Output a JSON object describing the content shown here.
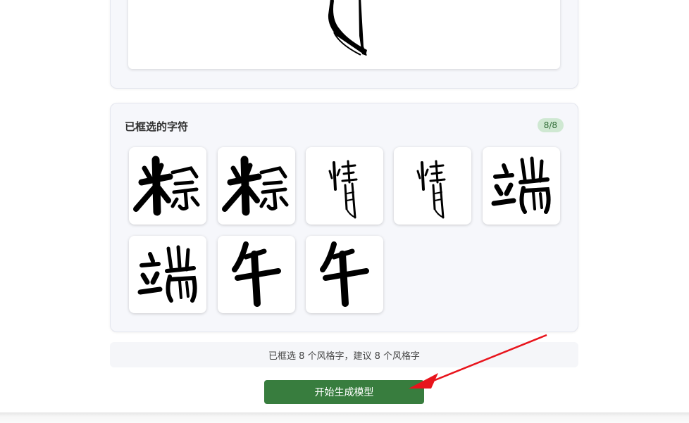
{
  "selected_panel": {
    "title": "已框选的字符",
    "badge": "8/8",
    "glyphs": [
      {
        "char": "粽"
      },
      {
        "char": "粽"
      },
      {
        "char": "情"
      },
      {
        "char": "情"
      },
      {
        "char": "端"
      },
      {
        "char": "端"
      },
      {
        "char": "午"
      },
      {
        "char": "午"
      }
    ]
  },
  "tip": {
    "text": "已框选 8 个风格字，建议 8 个风格字"
  },
  "actions": {
    "generate_label": "开始生成模型"
  },
  "annotation": {
    "arrow_color": "#e8141c"
  },
  "colors": {
    "primary_button": "#387d3e",
    "badge_bg": "#cfe8d2",
    "badge_text": "#2e6b35"
  }
}
